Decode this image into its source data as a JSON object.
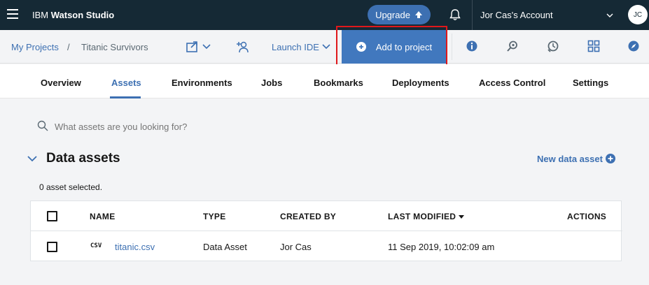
{
  "topbar": {
    "brand_prefix": "IBM ",
    "brand_name": "Watson Studio",
    "upgrade_label": "Upgrade",
    "account_label": "Jor Cas's Account",
    "avatar_initials": "JC"
  },
  "subbar": {
    "breadcrumb_root": "My Projects",
    "breadcrumb_sep": "/",
    "breadcrumb_current": "Titanic Survivors",
    "launch_ide_label": "Launch IDE",
    "add_to_project_label": "Add to project"
  },
  "tabs": [
    {
      "label": "Overview"
    },
    {
      "label": "Assets",
      "active": true
    },
    {
      "label": "Environments"
    },
    {
      "label": "Jobs"
    },
    {
      "label": "Bookmarks"
    },
    {
      "label": "Deployments"
    },
    {
      "label": "Access Control"
    },
    {
      "label": "Settings"
    }
  ],
  "search": {
    "placeholder": "What assets are you looking for?"
  },
  "data_assets": {
    "title": "Data assets",
    "new_asset_label": "New data asset",
    "selected_text": "0 asset selected.",
    "columns": {
      "name": "NAME",
      "type": "TYPE",
      "created_by": "CREATED BY",
      "last_modified": "LAST MODIFIED",
      "actions": "ACTIONS"
    },
    "rows": [
      {
        "badge": "CSV",
        "name": "titanic.csv",
        "type": "Data Asset",
        "created_by": "Jor Cas",
        "last_modified": "11 Sep 2019, 10:02:09 am"
      }
    ]
  },
  "colors": {
    "topbar_bg": "#152935",
    "accent": "#3d70b2",
    "highlight_border": "#e0181b"
  },
  "icons": [
    "menu-icon",
    "upload-icon",
    "bell-icon",
    "chevron-down-icon",
    "share-icon",
    "add-collaborator-icon",
    "plus-circle-icon",
    "info-icon",
    "search-icon",
    "schedule-icon",
    "assets-grid-icon",
    "compass-icon"
  ]
}
